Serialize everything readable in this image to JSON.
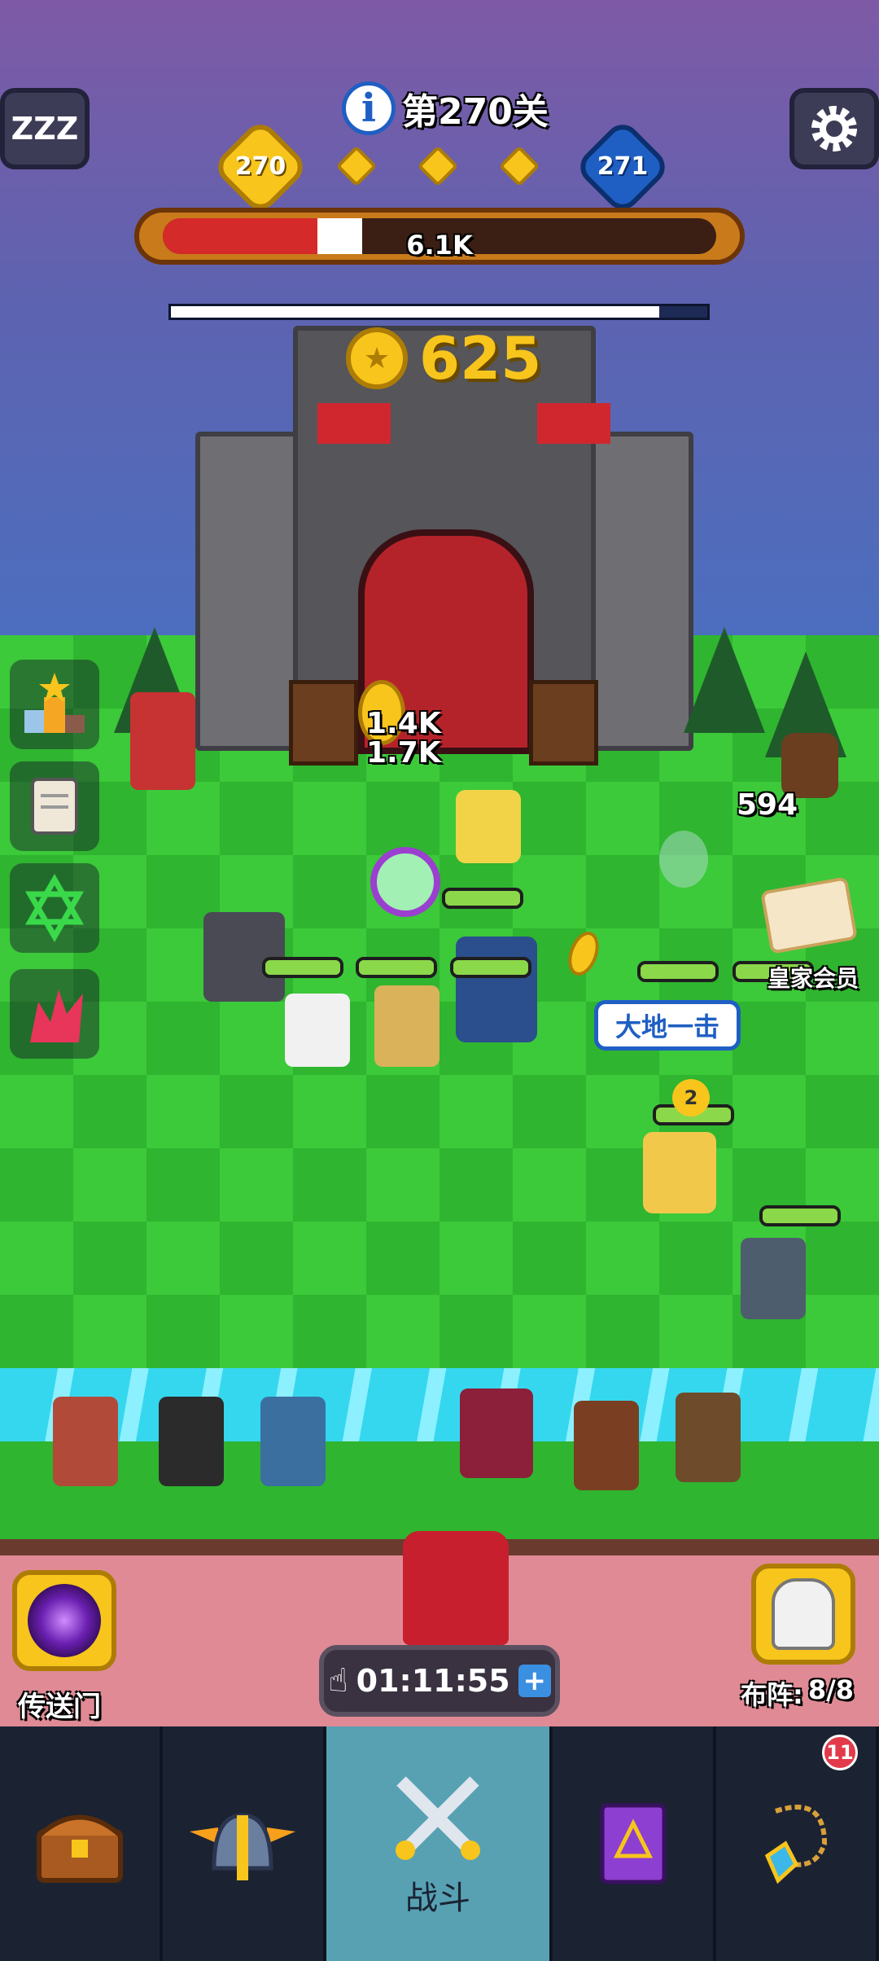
{
  "level": {
    "label": "第270关"
  },
  "sleep_button": {
    "label": "ZZZ"
  },
  "progress": {
    "current_level": "270",
    "next_level": "271",
    "stage_markers": 3
  },
  "boss": {
    "hp_text": "6.1K",
    "hp_fraction": 0.28,
    "shield_fraction": 0.91
  },
  "coins": {
    "value": "625"
  },
  "floating_damage": [
    {
      "text": "1.4K"
    },
    {
      "text": "1.7K"
    },
    {
      "text": "594"
    }
  ],
  "skill_bubble": {
    "label": "大地一击"
  },
  "royal_member": {
    "label": "皇家会员"
  },
  "enemy_level_badge": "2",
  "portal": {
    "label": "传送门"
  },
  "formation": {
    "label": "布阵:",
    "value": "8/8"
  },
  "timer": {
    "value": "01:11:55"
  },
  "nav": {
    "items": [
      {
        "name": "chest-icon",
        "label": ""
      },
      {
        "name": "helmet-icon",
        "label": ""
      },
      {
        "name": "crossed-swords-icon",
        "label": "战斗"
      },
      {
        "name": "spellbook-icon",
        "label": ""
      },
      {
        "name": "amulet-icon",
        "label": "",
        "badge": "11"
      }
    ]
  },
  "colors": {
    "hp_red": "#d52a2a",
    "hp_green": "#8bd84a",
    "gold": "#f7c51c",
    "blue_hex": "#1f5fc4"
  }
}
